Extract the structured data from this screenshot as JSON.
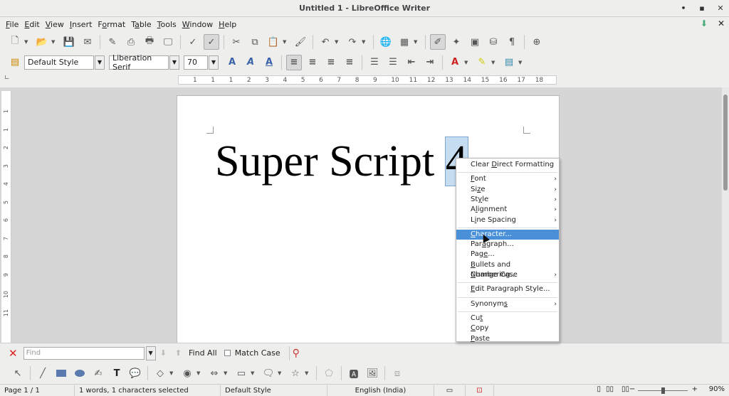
{
  "window": {
    "title": "Untitled 1 - LibreOffice Writer",
    "controls": [
      "•",
      "▪",
      "✕"
    ]
  },
  "menu": [
    {
      "pre": "",
      "u": "F",
      "post": "ile"
    },
    {
      "pre": "",
      "u": "E",
      "post": "dit"
    },
    {
      "pre": "",
      "u": "V",
      "post": "iew"
    },
    {
      "pre": "",
      "u": "I",
      "post": "nsert"
    },
    {
      "pre": "F",
      "u": "o",
      "post": "rmat"
    },
    {
      "pre": "T",
      "u": "a",
      "post": "ble"
    },
    {
      "pre": "",
      "u": "T",
      "post": "ools"
    },
    {
      "pre": "",
      "u": "W",
      "post": "indow"
    },
    {
      "pre": "",
      "u": "H",
      "post": "elp"
    }
  ],
  "toolbar1": [
    {
      "name": "new-icon",
      "glyph": "🗋",
      "dd": true
    },
    {
      "name": "open-icon",
      "glyph": "📂",
      "dd": true
    },
    {
      "name": "save-icon",
      "glyph": "💾",
      "dd": false
    },
    {
      "name": "email-icon",
      "glyph": "✉",
      "dd": false
    },
    {
      "name": "edit-file-icon",
      "glyph": "✎",
      "dd": false
    },
    {
      "name": "export-pdf-icon",
      "glyph": "⎙",
      "dd": false
    },
    {
      "name": "print-icon",
      "glyph": "🖶",
      "dd": false
    },
    {
      "name": "print-preview-icon",
      "glyph": "🖵",
      "dd": false
    },
    {
      "name": "spellcheck-icon",
      "glyph": "✓",
      "dd": false
    },
    {
      "name": "autospellcheck-icon",
      "glyph": "✓",
      "dd": false
    },
    {
      "name": "cut-icon",
      "glyph": "✂",
      "dd": false
    },
    {
      "name": "copy-icon",
      "glyph": "⧉",
      "dd": false
    },
    {
      "name": "paste-icon",
      "glyph": "📋",
      "dd": true
    },
    {
      "name": "clone-format-icon",
      "glyph": "🖌",
      "dd": false
    },
    {
      "name": "undo-icon",
      "glyph": "↶",
      "dd": true
    },
    {
      "name": "redo-icon",
      "glyph": "↷",
      "dd": true
    },
    {
      "name": "hyperlink-icon",
      "glyph": "🌐",
      "dd": false
    },
    {
      "name": "table-icon",
      "glyph": "▦",
      "dd": true
    },
    {
      "name": "draw-functions-icon",
      "glyph": "✐",
      "dd": false
    },
    {
      "name": "navigator-icon",
      "glyph": "✦",
      "dd": false
    },
    {
      "name": "gallery-icon",
      "glyph": "▣",
      "dd": false
    },
    {
      "name": "data-sources-icon",
      "glyph": "⛁",
      "dd": false
    },
    {
      "name": "formatting-marks-icon",
      "glyph": "¶",
      "dd": false
    },
    {
      "name": "help-icon",
      "glyph": "⊕",
      "dd": false
    }
  ],
  "toolbar2": {
    "style_value": "Default Style",
    "font_value": "Liberation Serif",
    "size_value": "70",
    "buttons": [
      {
        "name": "bold-icon",
        "glyph": "A"
      },
      {
        "name": "italic-icon",
        "glyph": "A"
      },
      {
        "name": "underline-icon",
        "glyph": "A"
      },
      {
        "name": "align-left-icon",
        "glyph": "≡"
      },
      {
        "name": "align-center-icon",
        "glyph": "≡"
      },
      {
        "name": "align-right-icon",
        "glyph": "≡"
      },
      {
        "name": "justify-icon",
        "glyph": "≡"
      },
      {
        "name": "numbering-icon",
        "glyph": "☰"
      },
      {
        "name": "bullets-icon",
        "glyph": "☰"
      },
      {
        "name": "decrease-indent-icon",
        "glyph": "⇤"
      },
      {
        "name": "increase-indent-icon",
        "glyph": "⇥"
      },
      {
        "name": "font-color-icon",
        "glyph": "A"
      },
      {
        "name": "highlight-icon",
        "glyph": "✎"
      },
      {
        "name": "background-color-icon",
        "glyph": "▤"
      }
    ]
  },
  "ruler": {
    "labels": [
      "1",
      "1",
      "1",
      "2",
      "3",
      "4",
      "5",
      "6",
      "7",
      "8",
      "9",
      "10",
      "11",
      "12",
      "13",
      "14",
      "15",
      "16",
      "17",
      "18"
    ]
  },
  "vruler": {
    "labels": [
      "1",
      "1",
      "2",
      "3",
      "4",
      "5",
      "6",
      "7",
      "8",
      "9",
      "10",
      "11"
    ]
  },
  "document": {
    "text": "Super Script ",
    "selected": "4"
  },
  "context_menu": [
    {
      "label": "Clear Direct Formatting",
      "submenu": false
    },
    {
      "sep": true
    },
    {
      "label": "Font",
      "submenu": true
    },
    {
      "label": "Size",
      "submenu": true
    },
    {
      "label": "Style",
      "submenu": true
    },
    {
      "label": "Alignment",
      "submenu": true
    },
    {
      "label": "Line Spacing",
      "submenu": true
    },
    {
      "sep": true
    },
    {
      "label": "Character...",
      "submenu": false,
      "highlighted": true
    },
    {
      "label": "Paragraph...",
      "submenu": false
    },
    {
      "label": "Page...",
      "submenu": false
    },
    {
      "label": "Bullets and Numbering...",
      "submenu": false
    },
    {
      "label": "Change Case",
      "submenu": true
    },
    {
      "sep": true
    },
    {
      "label": "Edit Paragraph Style...",
      "submenu": false
    },
    {
      "sep": true
    },
    {
      "label": "Synonyms",
      "submenu": true
    },
    {
      "sep": true
    },
    {
      "label": "Cut",
      "submenu": false
    },
    {
      "label": "Copy",
      "submenu": false
    },
    {
      "label": "Paste",
      "submenu": false
    }
  ],
  "findbar": {
    "placeholder": "Find",
    "find_all": "Find All",
    "match_case": "Match Case"
  },
  "status": {
    "page": "Page 1 / 1",
    "words": "1 words, 1 characters selected",
    "style": "Default Style",
    "language": "English (India)",
    "zoom": "90%",
    "zoom_level": 0.5
  },
  "colors": {
    "highlight": "#4a90d9",
    "selection": "#c6dcf0"
  }
}
